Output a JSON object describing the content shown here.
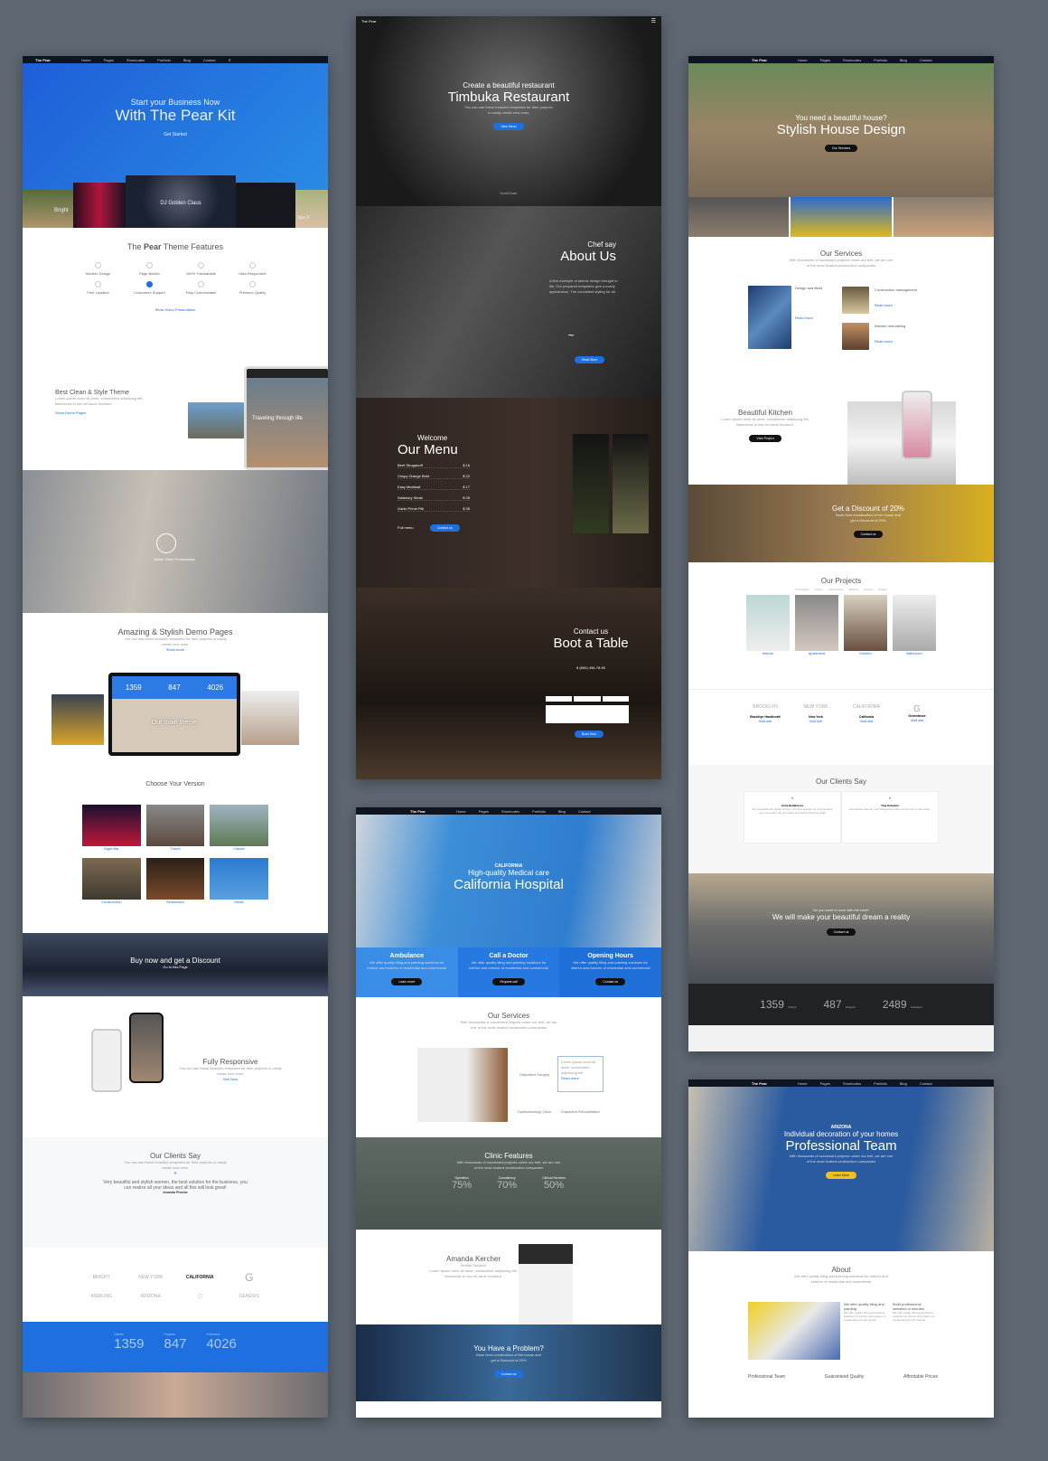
{
  "pear_kit": {
    "nav": {
      "logo": "The Pear",
      "items": [
        "Home",
        "Pages",
        "Shortcodes",
        "Portfolio",
        "Blog",
        "Contact"
      ]
    },
    "hero": {
      "subtitle": "Start your Business Now",
      "title": "With The Pear Kit",
      "cta": "Get Started",
      "slide_caption": "DJ Golden Claus",
      "left_caption": "Bright",
      "right_caption": "Spa S"
    },
    "features": {
      "title_pre": "The ",
      "title_bold": "Pear",
      "title_post": " Theme Features",
      "items": [
        "Modern Design",
        "Page Builder",
        "100% Translatable",
        "Ultra Responsive",
        "Free Updates",
        "Customers Support",
        "Fully Customizable",
        "Premium Quality"
      ],
      "link": "Show Video Presentation"
    },
    "clean": {
      "title": "Best Clean & Style Theme",
      "text": "Lorem ipsum dolor sit amet, consectetur adipiscing elit. Maecenas id nisl vel lacus tincidunt.",
      "link": "Show Demo Pages",
      "tablet_caption": "Traveling through life"
    },
    "video": {
      "label": "Watch Video Presentation"
    },
    "demos": {
      "title": "Amazing & Stylish Demo Pages",
      "text": "You can use these beautiful templates for their projects or easily create new ones.",
      "link": "Show more",
      "laptop_stats": [
        "1359",
        "847",
        "4026"
      ],
      "laptop_caption": "Our main theme"
    },
    "versions": {
      "title": "Choose Your Version",
      "items": [
        "Night Bar",
        "Travel",
        "Classic",
        "Construction",
        "Restaurant",
        "Medic"
      ]
    },
    "discount": {
      "title": "Buy now and get a Discount",
      "link": "Go to this Page"
    },
    "responsive": {
      "title": "Fully Responsive",
      "text": "You can use these beautiful templates for their projects or easily create new ones.",
      "link": "See Now"
    },
    "clients": {
      "title": "Our Clients Say",
      "text": "You can use these beautiful templates for their projects or easily create new ones.",
      "quote": "Very beautiful and stylish women, the best solution for the business, you can realize all your ideas and all this will look great!",
      "author": "Amanda Phoebe"
    },
    "logos": [
      "BRIGHT",
      "NEW YORK",
      "CALIFORNIA",
      "G",
      "KIERLING",
      "ARIZONA",
      "",
      "GENESIS"
    ],
    "stats": [
      {
        "label": "Clients",
        "value": "1359"
      },
      {
        "label": "Projects",
        "value": "847"
      },
      {
        "label": "Followers",
        "value": "4026"
      }
    ]
  },
  "restaurant": {
    "nav": {
      "logo": "The Pear"
    },
    "hero": {
      "subtitle": "Create a beautiful restaurant",
      "title": "Timbuka Restaurant",
      "text": "You can use these beautiful templates for their projects or easily create new ones.",
      "cta": "View Menu",
      "scroll": "Scroll Down"
    },
    "about": {
      "subtitle": "Chef say",
      "title": "About Us",
      "text": "A fine example of atomic design brought to life. Our prepared templates give a lovely appearance. The consistent styling for all.",
      "cta": "Read More"
    },
    "menu": {
      "subtitle": "Welcome",
      "title": "Our Menu",
      "items": [
        {
          "name": "Beef Stroganoff",
          "price": "$ 16"
        },
        {
          "name": "Crispy Orange Beef",
          "price": "$ 22"
        },
        {
          "name": "Easy Meatloaf",
          "price": "$ 17"
        },
        {
          "name": "Salisbury Steak",
          "price": "$ 28"
        },
        {
          "name": "Garlic Prime Rib",
          "price": "$ 35"
        }
      ],
      "link": "Full menu",
      "cta": "Contact us"
    },
    "booking": {
      "subtitle": "Contact us",
      "title": "Boot a Table",
      "phone": "8 (800) 456-78-90",
      "cta": "Book Now"
    }
  },
  "hospital": {
    "nav": {
      "logo": "The Pear",
      "items": [
        "Home",
        "Pages",
        "Shortcodes",
        "Portfolio",
        "Blog",
        "Contact"
      ]
    },
    "hero": {
      "brand": "CALIFORNIA",
      "subtitle": "High-quality Medical care",
      "title": "California Hospital"
    },
    "boxes": [
      {
        "title": "Ambulance",
        "btn": "Learn more"
      },
      {
        "title": "Call a Doctor",
        "btn": "Request call"
      },
      {
        "title": "Opening Hours",
        "btn": "Contact us"
      }
    ],
    "boxes_text": "We offer quality tiling and painting solutions for interior and exterior of residential and commercial",
    "services": {
      "title": "Our Services",
      "text": "With thousands of successful projects under our belt, we are one of the most trusted construction companies",
      "items": [
        "Outpatient Surgery",
        "Ophthalmology Clinic",
        "Outpatient Rehabilitation"
      ],
      "card_text": "Lorem ipsum dolor sit amet, consectetur adipiscing elit.",
      "card_link": "Read more"
    },
    "clinic": {
      "title": "Clinic Features",
      "text": "With thousands of successful projects under our belt, we are one of the most trusted construction companies",
      "items": [
        {
          "label": "Operation",
          "value": "75%"
        },
        {
          "label": "Consistency",
          "value": "70%"
        },
        {
          "label": "Clinical Services",
          "value": "50%"
        }
      ]
    },
    "doctor": {
      "name": "Amanda Kercher",
      "role": "Dentist Surgeon",
      "quote": "Lorem ipsum dolor sit amet, consectetur adipiscing elit. Maecenas id nisl vel lacus tincidunt."
    },
    "problem": {
      "title": "You Have a Problem?",
      "text": "Book Now construction of the house and get a Discount of 20%",
      "cta": "Contact us"
    }
  },
  "construction": {
    "nav": {
      "logo": "The Pear",
      "items": [
        "Home",
        "Pages",
        "Shortcodes",
        "Portfolio",
        "Blog",
        "Contact"
      ]
    },
    "hero": {
      "subtitle": "You need a beautiful house?",
      "title": "Stylish House Design",
      "cta": "Our Services"
    },
    "services": {
      "title": "Our Services",
      "text": "With thousands of successful projects under our belt, we are one of the most trusted construction companies",
      "items": [
        {
          "title": "Design and Build",
          "link": "Read more"
        },
        {
          "title": "Construction management",
          "link": "Read more"
        },
        {
          "title": "Kitchen remodeling",
          "link": "Read more"
        }
      ]
    },
    "kitchen": {
      "title": "Beautiful Kitchen",
      "text": "Lorem ipsum dolor sit amet, consectetur adipiscing elit. Maecenas id nisl vel lacus tincidunt.",
      "cta": "View Project"
    },
    "discount": {
      "title": "Get a Discount of 20%",
      "text": "Book Now construction of the house and get a Discount of 20%",
      "cta": "Contact us"
    },
    "projects": {
      "title": "Our Projects",
      "filters": [
        "All Projects",
        "Interior",
        "Construction",
        "Building",
        "Kitchen",
        "Design"
      ],
      "items": [
        "Interior",
        "Apartment",
        "Kitchen",
        "Bathroom"
      ]
    },
    "partners": [
      {
        "logo": "BROOKLYN",
        "name": "Brooklyn Handicraft",
        "link": "Visit site"
      },
      {
        "logo": "NEW YORK",
        "name": "New York",
        "link": "Visit site"
      },
      {
        "logo": "CALIFORNIA",
        "name": "California",
        "link": "Visit site"
      },
      {
        "logo": "G",
        "name": "Greenfance",
        "link": "Visit site"
      }
    ],
    "clients": {
      "title": "Our Clients Say",
      "items": [
        {
          "author": "Anna Bellafrance",
          "quote": "Very beautiful and stylish women, the best solution for the business, you can realize all your ideas and all this will look great!"
        },
        {
          "author": "Tina Karamen",
          "quote": "Remember that the most dangerous prison is the one in your head."
        }
      ]
    },
    "city": {
      "subtitle": "Do you want to work with the best?",
      "title": "We will make your beautiful dream a reality",
      "cta": "Contact us"
    },
    "stats": [
      {
        "label": "Clients",
        "value": "1359"
      },
      {
        "label": "Projects",
        "value": "487"
      },
      {
        "label": "Followers",
        "value": "2489"
      }
    ]
  },
  "team": {
    "nav": {
      "logo": "The Pear",
      "items": [
        "Home",
        "Pages",
        "Shortcodes",
        "Portfolio",
        "Blog",
        "Contact"
      ]
    },
    "hero": {
      "brand": "ARIZONA",
      "subtitle": "Individual decoration of your homes",
      "title": "Professional Team",
      "text": "With thousands of successful projects under our belt, we are one of the most trusted construction companies",
      "cta": "Learn More"
    },
    "about": {
      "title": "About",
      "text": "We offer quality tiling and painting solutions for interior and exterior of residential and commercial",
      "col1_title": "We offer quality tiling and painting",
      "col2_title": "Build professional websites in minutes",
      "col_text": "We offer quality tiling and painting solutions for interior and exterior of residential and commercial.",
      "features": [
        "Professional Team",
        "Guaranteed Quality",
        "Affordable Prices"
      ]
    }
  },
  "colors": {
    "accent": "#1e6fe0",
    "dark": "#0e1420",
    "background": "#5e6772"
  }
}
